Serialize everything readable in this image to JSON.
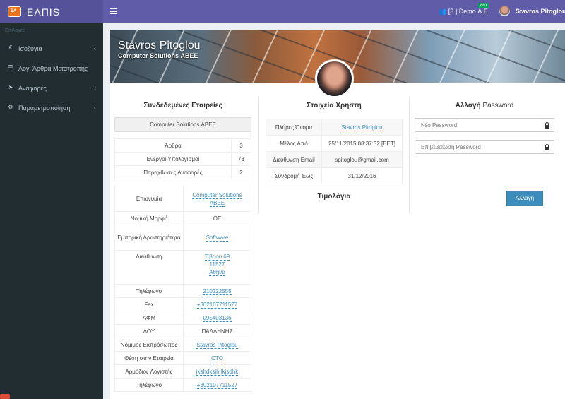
{
  "topbar": {
    "logo_text": "ΕΛΠΙS",
    "logo_badge": "ΕΛΠΙS",
    "company_menu": "[3 ] Demo Α.Ε.",
    "year_badge": "2011",
    "user_name": "Stavros Pitoglou",
    "menu_icon": "hamburger-icon",
    "users_icon": "users-icon"
  },
  "sidebar": {
    "header": "Επιλογές",
    "items": [
      {
        "icon": "euro-icon",
        "glyph": "€",
        "label": "Ισοζύγια",
        "chevron": "‹"
      },
      {
        "icon": "list-icon",
        "glyph": "☰",
        "label": "Λογ. Άρθρα Μετατροπής",
        "chevron": ""
      },
      {
        "icon": "send-icon",
        "glyph": "➤",
        "label": "Αναφορές",
        "chevron": "‹"
      },
      {
        "icon": "cogs-icon",
        "glyph": "⚙",
        "label": "Παραμετροποίηση",
        "chevron": "‹"
      }
    ]
  },
  "banner": {
    "name": "Stavros Pitoglou",
    "company": "Computer Solutions ΑΒΕΕ"
  },
  "left": {
    "title": "Συνδεδεμένες Εταιρείες",
    "company_button": "Computer Solutions ΑΒΕΕ",
    "stats": [
      {
        "label": "Άρθρα",
        "value": "3"
      },
      {
        "label": "Ενεργοί Υπολογισμοί",
        "value": "78"
      },
      {
        "label": "Παραχθείσες Αναφορές",
        "value": "2"
      }
    ],
    "details": {
      "name_key": "Επωνυμία",
      "name_val": "Computer Solutions ΑΒΕΕ",
      "legal_key": "Νομική Μορφή",
      "legal_val": "ΟΕ",
      "activity_key": "Εμπορική Δραστηριότητα",
      "activity_val": "Software",
      "address_key": "Διεύθυνση",
      "address_line1": "Έβρου 69",
      "address_line2": "11527",
      "address_line3": "Αθήνα",
      "phone_key": "Τηλέφωνο",
      "phone_val": "210222555",
      "fax_key": "Fax",
      "fax_val": "+302107711527",
      "afm_key": "ΑΦΜ",
      "afm_val": "095403136",
      "doy_key": "ΔΟΥ",
      "doy_val": "ΠΑΛΛΗΝΗΣ",
      "rep_key": "Νόμιμος Εκπρόσωπος",
      "rep_val": "Stavros Pitoglou",
      "position_key": "Θέση στην Εταιρεία",
      "position_val": "CTO",
      "accountant_key": "Αρμόδιος Λογιστής",
      "accountant_val": "jkshdksjh lkjsdhk",
      "phone2_key": "Τηλέφωνο",
      "phone2_val": "+302107711527"
    }
  },
  "middle": {
    "title": "Στοιχεία Χρήστη",
    "rows": [
      {
        "key": "Πλήρες Όνομα",
        "value": "Stavros Pitoglou"
      },
      {
        "key": "Μέλος Από",
        "value": "25/11/2015 08:37:32 [EET]"
      },
      {
        "key": "Διεύθυνση Email",
        "value": "spitoglou@gmail.com"
      },
      {
        "key": "Συνδρομή Έως",
        "value": "31/12/2016"
      }
    ],
    "invoices_title": "Τιμολόγια"
  },
  "right": {
    "title_bold": "Αλλαγή",
    "title_rest": "Password",
    "new_password_placeholder": "Νέο Password",
    "confirm_password_placeholder": "Επιβεβαίωση Password",
    "submit_label": "Αλλαγή"
  },
  "colors": {
    "topbar": "#605ca8",
    "sidebar": "#222d32",
    "accent": "#3c8dbc",
    "badge": "#00a65a"
  }
}
